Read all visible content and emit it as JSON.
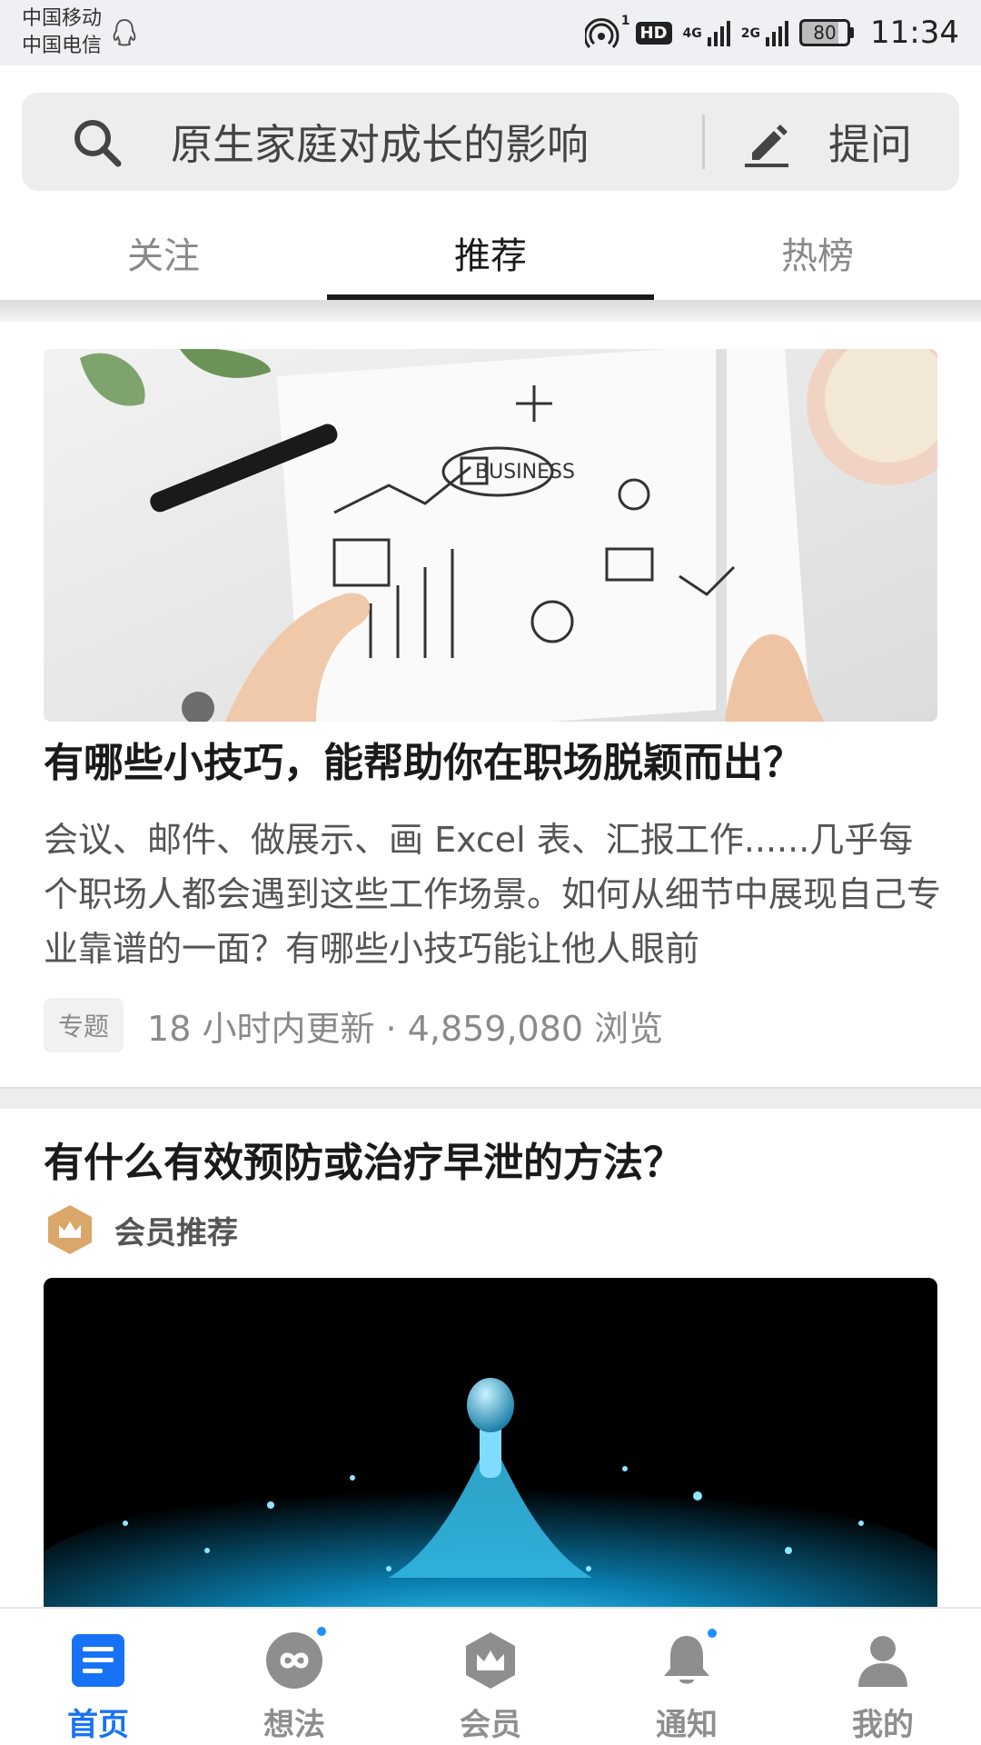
{
  "status_bar": {
    "carrier1": "中国移动",
    "carrier2": "中国电信",
    "hotspot_sup": "1",
    "hd": "HD",
    "net1": "4G",
    "net2": "2G",
    "battery": "80",
    "time": "11:34",
    "battery_level_percent": 80
  },
  "search": {
    "placeholder": "原生家庭对成长的影响",
    "ask_label": "提问",
    "icon": "search-icon",
    "ask_icon": "pencil-icon"
  },
  "tabs": [
    {
      "label": "关注",
      "active": false
    },
    {
      "label": "推荐",
      "active": true
    },
    {
      "label": "热榜",
      "active": false
    }
  ],
  "feed": {
    "card1": {
      "title": "有哪些小技巧，能帮助你在职场脱颖而出？",
      "description": "会议、邮件、做展示、画 Excel 表、汇报工作......几乎每个职场人都会遇到这些工作场景。如何从细节中展现自己专业靠谱的一面？有哪些小技巧能让他人眼前",
      "tag": "专题",
      "meta": "18 小时内更新 · 4,859,080 浏览",
      "image_text": "BUSINESS"
    },
    "card2": {
      "title": "有什么有效预防或治疗早泄的方法？",
      "member_label": "会员推荐"
    }
  },
  "bottom_nav": [
    {
      "label": "首页",
      "icon": "home-icon",
      "active": true
    },
    {
      "label": "想法",
      "icon": "ideas-icon",
      "active": false
    },
    {
      "label": "会员",
      "icon": "member-icon",
      "active": false
    },
    {
      "label": "通知",
      "icon": "bell-icon",
      "active": false
    },
    {
      "label": "我的",
      "icon": "profile-icon",
      "active": false
    }
  ],
  "colors": {
    "accent": "#1772f6",
    "notification_dot": "#1e90ff",
    "inactive_nav": "#8e8e8e",
    "member_gold": "#d9a76a"
  }
}
